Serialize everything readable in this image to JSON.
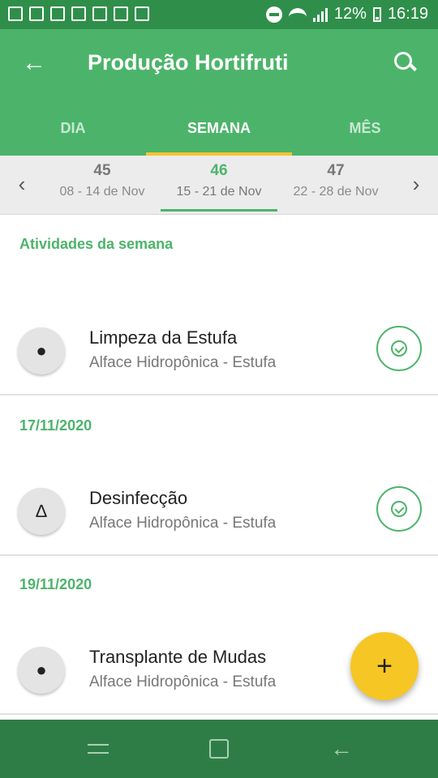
{
  "status_bar": {
    "battery": "12%",
    "time": "16:19"
  },
  "app_bar": {
    "title": "Produção Hortifruti"
  },
  "tabs": [
    "DIA",
    "SEMANA",
    "MÊS"
  ],
  "week_selector": {
    "weeks": [
      {
        "number": "45",
        "range": "08 - 14 de Nov"
      },
      {
        "number": "46",
        "range": "15 - 21 de Nov"
      },
      {
        "number": "47",
        "range": "22 - 28 de Nov"
      }
    ]
  },
  "section_header": "Atividades da semana",
  "groups": [
    {
      "date": "",
      "items": [
        {
          "title": "Limpeza da Estufa",
          "subtitle": "Alface Hidropônica - Estufa"
        }
      ]
    },
    {
      "date": "17/11/2020",
      "items": [
        {
          "title": "Desinfecção",
          "subtitle": "Alface Hidropônica - Estufa"
        }
      ]
    },
    {
      "date": "19/11/2020",
      "items": [
        {
          "title": "Transplante de Mudas",
          "subtitle": "Alface Hidropônica - Estufa"
        }
      ]
    }
  ],
  "icons": {
    "back": "arrow-left-icon",
    "search": "search-icon",
    "prev": "chevron-left-icon",
    "next": "chevron-right-icon",
    "fab": "plus-icon"
  },
  "colors": {
    "primary": "#4cb46a",
    "status_bar": "#2f8f4a",
    "accent": "#f4c430",
    "nav_bar": "#2f7d46"
  }
}
